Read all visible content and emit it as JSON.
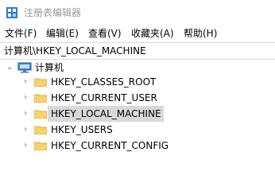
{
  "window": {
    "title": "注册表编辑器"
  },
  "menu": {
    "items": [
      {
        "label": "文件(F)"
      },
      {
        "label": "编辑(E)"
      },
      {
        "label": "查看(V)"
      },
      {
        "label": "收藏夹(A)"
      },
      {
        "label": "帮助(H)"
      }
    ]
  },
  "address": {
    "path": "计算机\\HKEY_LOCAL_MACHINE"
  },
  "tree": {
    "root": {
      "label": "计算机",
      "icon": "computer-icon",
      "expanded": true
    },
    "children": [
      {
        "label": "HKEY_CLASSES_ROOT",
        "selected": false
      },
      {
        "label": "HKEY_CURRENT_USER",
        "selected": false
      },
      {
        "label": "HKEY_LOCAL_MACHINE",
        "selected": true
      },
      {
        "label": "HKEY_USERS",
        "selected": false
      },
      {
        "label": "HKEY_CURRENT_CONFIG",
        "selected": false
      }
    ]
  },
  "colors": {
    "folder": "#f6d36b",
    "selection": "#d9d9d9",
    "title_text": "#9a9a9a"
  }
}
